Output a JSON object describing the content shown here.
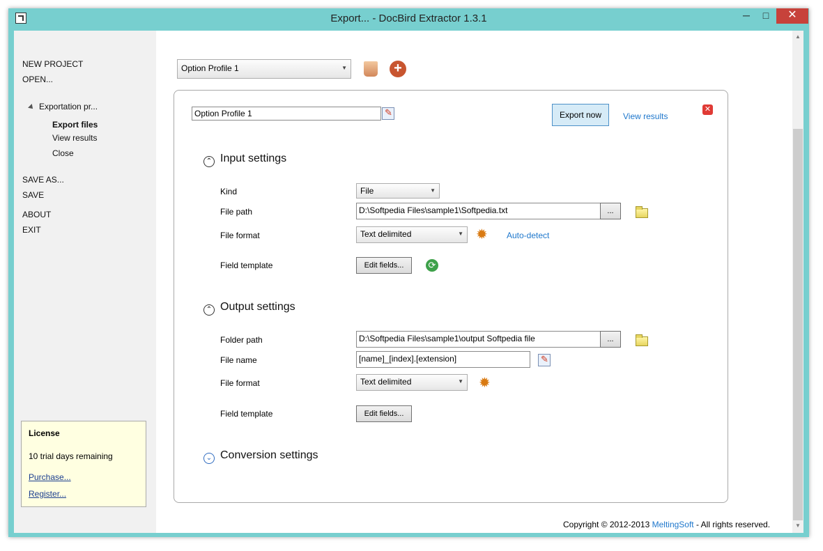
{
  "window": {
    "title": "Export... - DocBird Extractor 1.3.1",
    "min": "─",
    "max": "□",
    "close": "✕"
  },
  "sidebar": {
    "new_project": "NEW PROJECT",
    "open": "OPEN...",
    "tree_parent": "Exportation pr...",
    "tree_items": [
      "Export files",
      "View results",
      "Close"
    ],
    "save_as": "SAVE AS...",
    "save": "SAVE",
    "about": "ABOUT",
    "exit": "EXIT"
  },
  "license": {
    "title": "License",
    "desc": "10 trial days remaining",
    "purchase": "Purchase...",
    "register": "Register..."
  },
  "profile_select": {
    "value": "Option Profile 1"
  },
  "panel": {
    "profile_name": "Option Profile 1",
    "export_now": "Export now",
    "view_results": "View results",
    "input_settings": {
      "title": "Input settings",
      "kind_label": "Kind",
      "kind_value": "File",
      "file_path_label": "File path",
      "file_path_value": "D:\\Softpedia Files\\sample1\\Softpedia.txt",
      "browse": "...",
      "file_format_label": "File format",
      "file_format_value": "Text delimited",
      "auto_detect": "Auto-detect",
      "field_template_label": "Field template",
      "edit_fields": "Edit fields..."
    },
    "output_settings": {
      "title": "Output settings",
      "folder_path_label": "Folder path",
      "folder_path_value": "D:\\Softpedia Files\\sample1\\output Softpedia file",
      "browse": "...",
      "file_name_label": "File name",
      "file_name_value": "[name]_[index].[extension]",
      "file_format_label": "File format",
      "file_format_value": "Text delimited",
      "field_template_label": "Field template",
      "edit_fields": "Edit fields..."
    },
    "conversion_settings": {
      "title": "Conversion settings"
    }
  },
  "footer": {
    "copyright": "Copyright © 2012-2013",
    "company": "MeltingSoft",
    "rights": "- All rights reserved."
  },
  "icons": {
    "chevron_up": "⌃",
    "chevron_down": "⌄",
    "gear": "✹",
    "refresh": "⟳",
    "plus": "+",
    "close_x": "✕",
    "arrow_down": "▼",
    "arrow_up": "▲"
  }
}
